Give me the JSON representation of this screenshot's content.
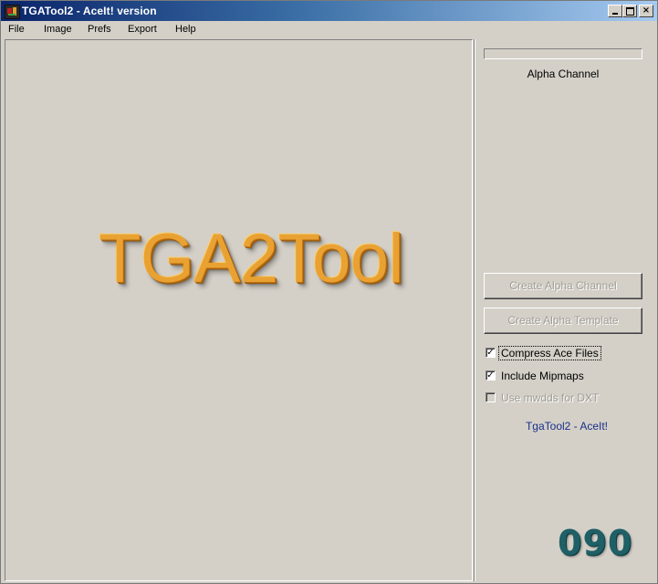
{
  "window": {
    "title": "TGATool2 - AceIt! version",
    "icon": "tgatool-app-icon",
    "caption_buttons": {
      "minimize": "minimize-icon",
      "maximize": "maximize-icon",
      "close_label": "×"
    }
  },
  "menu": {
    "items": [
      "File",
      "Image",
      "Prefs",
      "Export",
      "Help"
    ]
  },
  "canvas": {
    "logo_text": "TGA2Tool",
    "logo_color": "#e9a232"
  },
  "sidebar": {
    "alpha_label": "Alpha Channel",
    "buttons": {
      "create_alpha_channel": "Create Alpha Channel",
      "create_alpha_template": "Create Alpha Template"
    },
    "checkboxes": [
      {
        "label": "Compress Ace Files",
        "checked": "✓",
        "enabled": true
      },
      {
        "label": "Include Mipmaps",
        "checked": "✓",
        "enabled": true
      },
      {
        "label": "Use mwdds for DXT",
        "checked": "",
        "enabled": false
      }
    ],
    "footer": "TgaTool2 - AceIt!",
    "footer_color": "#1a2f8a"
  },
  "counter": {
    "text": "090",
    "color": "#1f5f66"
  }
}
